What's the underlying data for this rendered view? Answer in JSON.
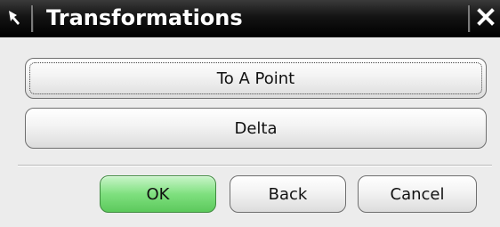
{
  "dialog": {
    "title": "Transformations",
    "title_icon": "select-arrow-icon",
    "close_icon": "close-icon"
  },
  "options": {
    "to_a_point_label": "To A Point",
    "delta_label": "Delta"
  },
  "footer": {
    "ok_label": "OK",
    "back_label": "Back",
    "cancel_label": "Cancel"
  },
  "colors": {
    "titlebar": "#000000",
    "ok_button": "#7fe07f",
    "dialog_background": "#ececec"
  }
}
